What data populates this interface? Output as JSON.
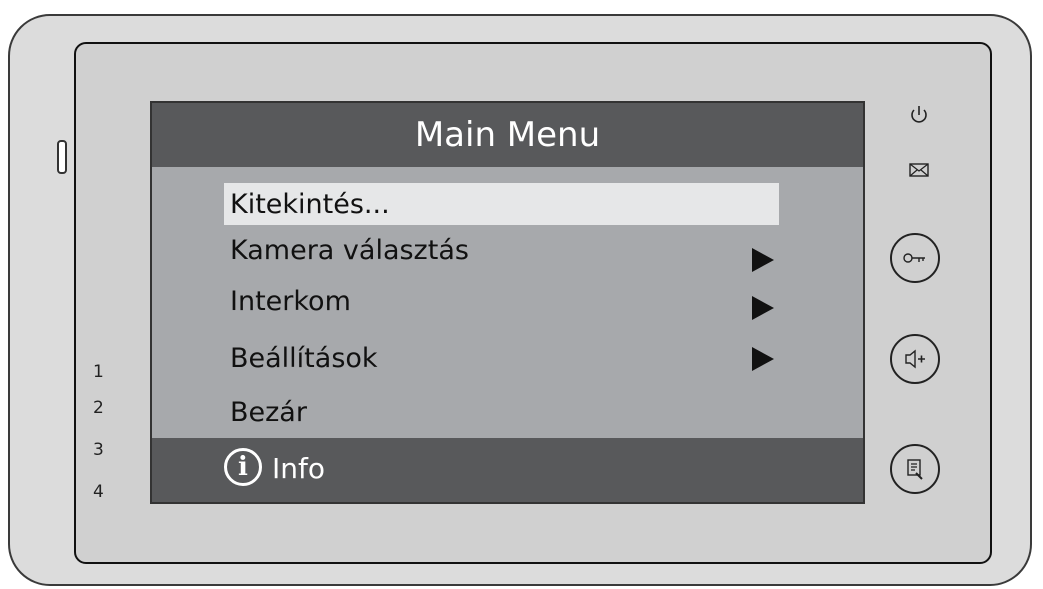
{
  "screen": {
    "title": "Main Menu",
    "menu_items": [
      {
        "label": "Kitekintés...",
        "selected": true,
        "has_submenu": false
      },
      {
        "label": "Kamera választás",
        "selected": false,
        "has_submenu": true
      },
      {
        "label": "Interkom",
        "selected": false,
        "has_submenu": true
      },
      {
        "label": "Beállítások",
        "selected": false,
        "has_submenu": true
      },
      {
        "label": "Bezár",
        "selected": false,
        "has_submenu": false
      }
    ],
    "footer": {
      "icon": "info-icon",
      "icon_glyph": "i",
      "label": "Info"
    }
  },
  "camera_indicators": [
    "1",
    "2",
    "3",
    "4"
  ],
  "hardware_buttons": [
    {
      "name": "power-icon"
    },
    {
      "name": "message-icon"
    },
    {
      "name": "door-key-button"
    },
    {
      "name": "talk-button"
    },
    {
      "name": "monitor-button"
    }
  ]
}
